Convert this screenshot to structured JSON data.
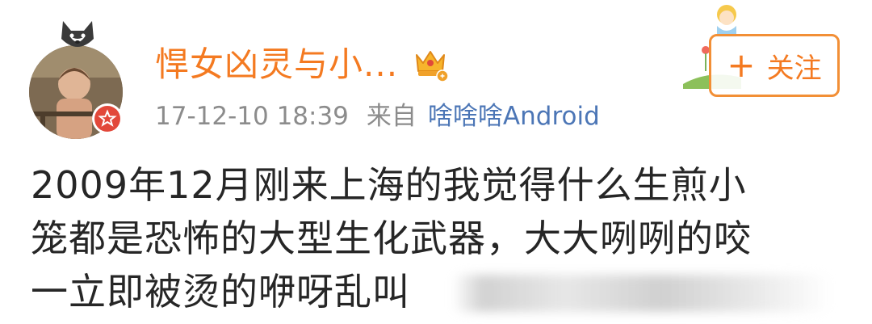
{
  "post": {
    "user": {
      "name": "悍女凶灵与小...",
      "timestamp": "17-12-10 18:39",
      "from_label": "来自",
      "source": "啥啥啥Android"
    },
    "follow_button": {
      "icon": "plus-icon",
      "label": "关注"
    },
    "content_lines": [
      "2009年12月刚来上海的我觉得什么生煎小",
      "笼都是恐怖的大型生化武器，大大咧咧的咬",
      "一立即被烫的咿呀乱叫"
    ],
    "colors": {
      "username": "#f47a21",
      "source_link": "#4c76b6",
      "meta_text": "#8c8c8c",
      "body_text": "#262626",
      "follow_border": "#f28f36"
    }
  }
}
